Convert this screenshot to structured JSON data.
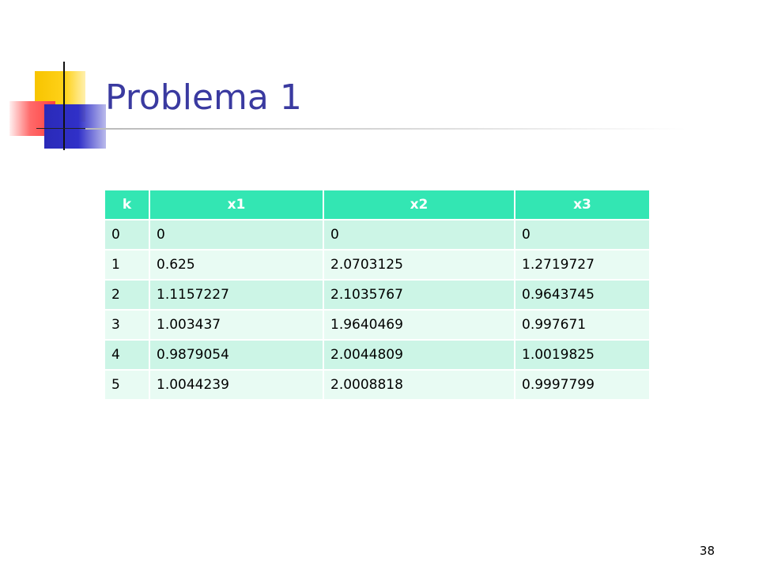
{
  "slide": {
    "title": "Problema 1",
    "page_number": "38"
  },
  "table": {
    "headers": [
      "k",
      "x1",
      "x2",
      "x3"
    ],
    "rows": [
      [
        "0",
        "0",
        "0",
        "0"
      ],
      [
        "1",
        "0.625",
        "2.0703125",
        "1.2719727"
      ],
      [
        "2",
        "1.1157227",
        "2.1035767",
        "0.9643745"
      ],
      [
        "3",
        "1.003437",
        "1.9640469",
        "0.997671"
      ],
      [
        "4",
        "0.9879054",
        "2.0044809",
        "1.0019825"
      ],
      [
        "5",
        "1.0044239",
        "2.0008818",
        "0.9997799"
      ]
    ]
  },
  "colors": {
    "title": "#3a3aa0",
    "header_bg": "#33e6b3",
    "row_odd_bg": "#ccf5e6",
    "row_even_bg": "#e8fbf3"
  }
}
